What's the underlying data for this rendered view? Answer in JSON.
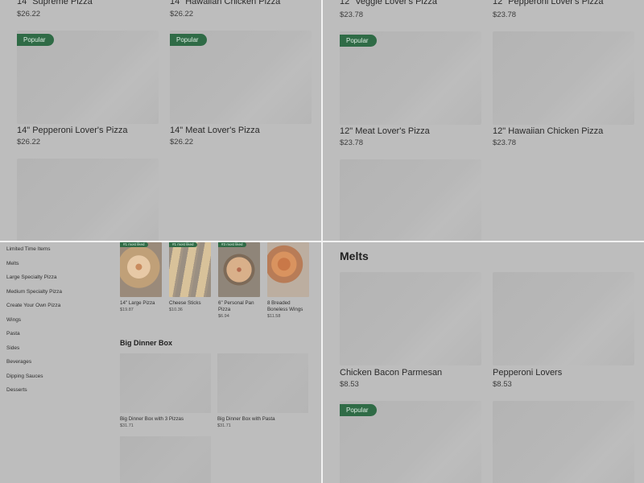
{
  "top_left": {
    "cards": [
      {
        "name": "14\" Supreme Pizza",
        "price": "$26.22",
        "badge": ""
      },
      {
        "name": "14\" Hawaiian Chicken Pizza",
        "price": "$26.22",
        "badge": ""
      },
      {
        "name": "14\" Pepperoni Lover's Pizza",
        "price": "$26.22",
        "badge": "Popular"
      },
      {
        "name": "14\" Meat Lover's Pizza",
        "price": "$26.22",
        "badge": "Popular"
      }
    ]
  },
  "top_right": {
    "cards": [
      {
        "name": "12\" Veggie Lover's Pizza",
        "price": "$23.78",
        "badge": ""
      },
      {
        "name": "12\" Pepperoni Lover's Pizza",
        "price": "$23.78",
        "badge": ""
      },
      {
        "name": "12\" Meat Lover's Pizza",
        "price": "$23.78",
        "badge": "Popular"
      },
      {
        "name": "12\" Hawaiian Chicken Pizza",
        "price": "$23.78",
        "badge": ""
      }
    ]
  },
  "bottom_left": {
    "sidebar": [
      "Limited Time Items",
      "Melts",
      "Large Specialty Pizza",
      "Medium Specialty Pizza",
      "Create Your Own Pizza",
      "Wings",
      "Pasta",
      "Sides",
      "Beverages",
      "Dipping Sauces",
      "Desserts"
    ],
    "most_liked": [
      {
        "tag": "#1 most liked",
        "name": "14\" Large Pizza",
        "price": "$19.87"
      },
      {
        "tag": "#1 most liked",
        "name": "Cheese Sticks",
        "price": "$10.36"
      },
      {
        "tag": "#3 most liked",
        "name": "6\" Personal Pan Pizza",
        "price": "$6.94"
      },
      {
        "tag": "",
        "name": "8 Breaded Boneless Wings",
        "price": "$11.58"
      }
    ],
    "section_title": "Big Dinner Box",
    "boxes": [
      {
        "name": "Big Dinner Box with 3 Pizzas",
        "price": "$31.71"
      },
      {
        "name": "Big Dinner Box with Pasta",
        "price": "$31.71"
      }
    ]
  },
  "bottom_right": {
    "section_title": "Melts",
    "cards": [
      {
        "name": "Chicken Bacon Parmesan",
        "price": "$8.53",
        "badge": ""
      },
      {
        "name": "Pepperoni Lovers",
        "price": "$8.53",
        "badge": ""
      },
      {
        "badge": "Popular"
      }
    ]
  },
  "colors": {
    "overlay_gray": "#bdbdbd",
    "badge_green": "#2f6b46",
    "divider": "#f2f2f2"
  }
}
